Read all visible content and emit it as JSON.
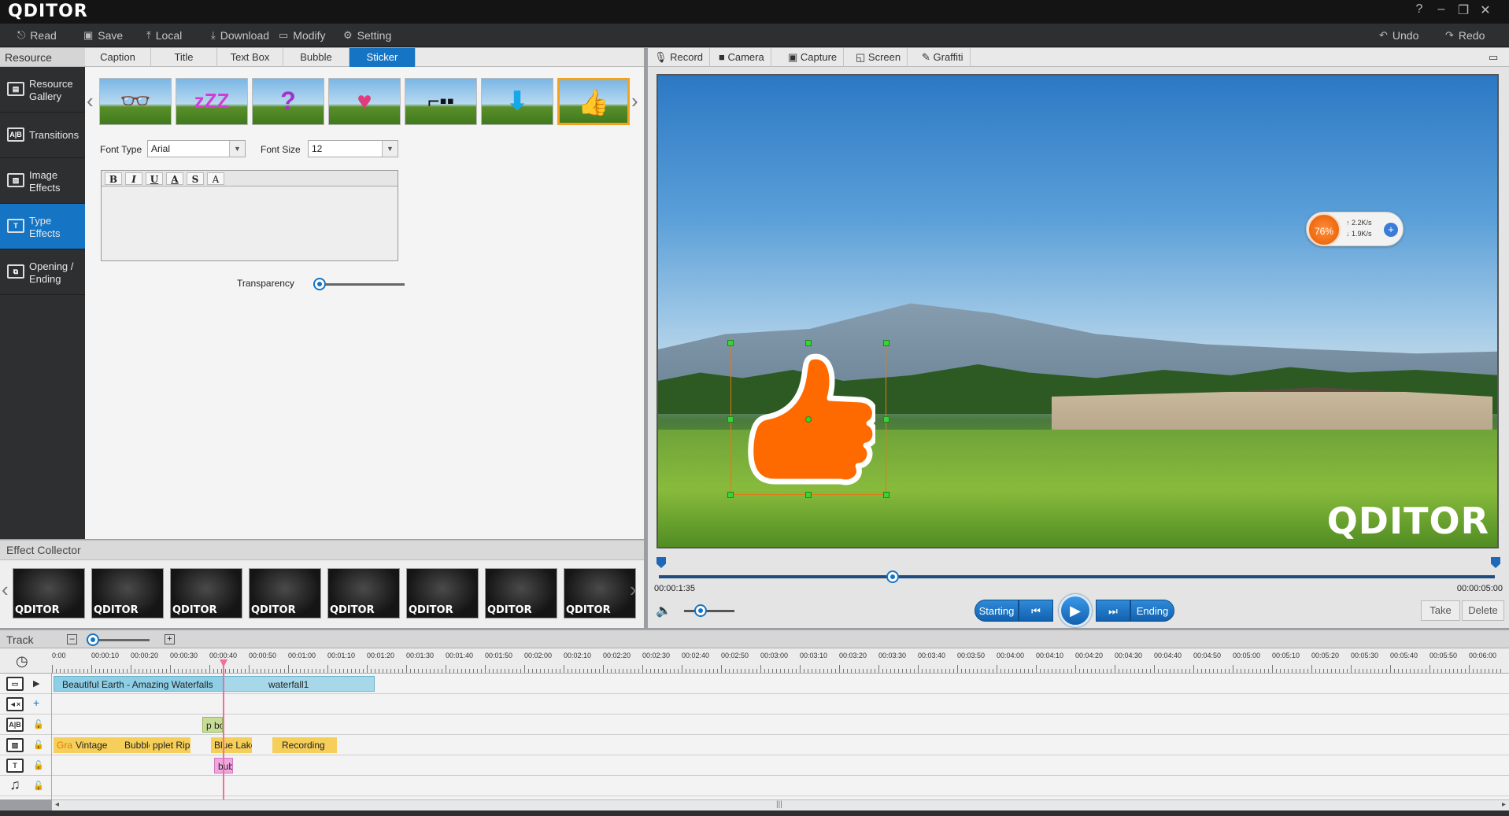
{
  "app": {
    "logo": "QDITOR",
    "window_controls": [
      "?",
      "–",
      "❐",
      "✕"
    ]
  },
  "toolbar": {
    "read": "Read",
    "save": "Save",
    "local": "Local",
    "download": "Download",
    "modify": "Modify",
    "setting": "Setting",
    "undo": "Undo",
    "redo": "Redo"
  },
  "resource_header": "Resource",
  "sidebar": {
    "items": [
      {
        "label_1": "Resource",
        "label_2": "Gallery",
        "icon": "gallery-icon"
      },
      {
        "label_1": "Transitions",
        "label_2": "",
        "icon": "transitions-icon"
      },
      {
        "label_1": "Image",
        "label_2": "Effects",
        "icon": "image-effects-icon"
      },
      {
        "label_1": "Type",
        "label_2": "Effects",
        "icon": "type-effects-icon",
        "active": true
      },
      {
        "label_1": "Opening /",
        "label_2": "Ending",
        "icon": "opening-ending-icon"
      }
    ]
  },
  "tabs": [
    "Caption",
    "Title",
    "Text Box",
    "Bubble",
    "Sticker"
  ],
  "active_tab": "Sticker",
  "stickers": [
    "sunglasses",
    "zzz",
    "question-mark",
    "heart",
    "glasses",
    "down-arrow",
    "thumbs-up"
  ],
  "selected_sticker": "thumbs-up",
  "text_panel": {
    "font_type_label": "Font Type",
    "font_type_value": "Arial",
    "font_size_label": "Font Size",
    "font_size_value": "12",
    "format_buttons": [
      "B",
      "I",
      "U",
      "A",
      "S",
      "A"
    ],
    "transparency_label": "Transparency",
    "transparency": 0
  },
  "effect_collector": {
    "title": "Effect Collector",
    "thumb_text": "QDITOR",
    "count": 8
  },
  "right_tools": [
    "Record",
    "Camera",
    "Capture",
    "Screen",
    "Graffiti"
  ],
  "preview": {
    "watermark": "QDITOR",
    "speed_widget": {
      "percent": "76%",
      "up": "2.2K/s",
      "down": "1.9K/s"
    }
  },
  "transport": {
    "current_time": "00:00:1:35",
    "total_time": "00:00:05:00",
    "progress": 0.28,
    "starting": "Starting",
    "ending": "Ending",
    "take": "Take",
    "delete": "Delete",
    "volume": 0.2
  },
  "track": {
    "title": "Track",
    "ruler_labels": [
      "0:00",
      "00:00:10",
      "00:00:20",
      "00:00:30",
      "00:00:40",
      "00:00:50",
      "00:01:00",
      "00:01:10",
      "00:01:20",
      "00:01:30",
      "00:01:40",
      "00:01:50",
      "00:02:00",
      "00:02:10",
      "00:02:20",
      "00:02:30",
      "00:02:40",
      "00:02:50",
      "00:03:00",
      "00:03:10",
      "00:03:20",
      "00:03:30",
      "00:03:40",
      "00:03:50",
      "00:04:00",
      "00:04:10",
      "00:04:20",
      "00:04:30",
      "00:04:40",
      "00:04:50",
      "00:05:00",
      "00:05:10",
      "00:05:20",
      "00:05:30",
      "00:05:40",
      "00:05:50",
      "00:06:00"
    ],
    "clips": {
      "video_1": "Beautiful Earth - Amazing Waterfalls",
      "video_2": "waterfall1",
      "textbox": "p bo",
      "image_fx": [
        "Graffiti",
        "Vintage",
        "Bubble",
        "pplet Ripp",
        "Blue Lake",
        "Recording"
      ],
      "type_fx": "bub"
    }
  },
  "colors": {
    "accent": "#1575c4",
    "sticker_orange": "#ff6a00",
    "clip_video": "#8ecfe6",
    "clip_effect": "#f5cf5a",
    "clip_bubble": "#f1a6e0",
    "clip_text": "#c7dd97",
    "playhead": "#f16d9c"
  }
}
